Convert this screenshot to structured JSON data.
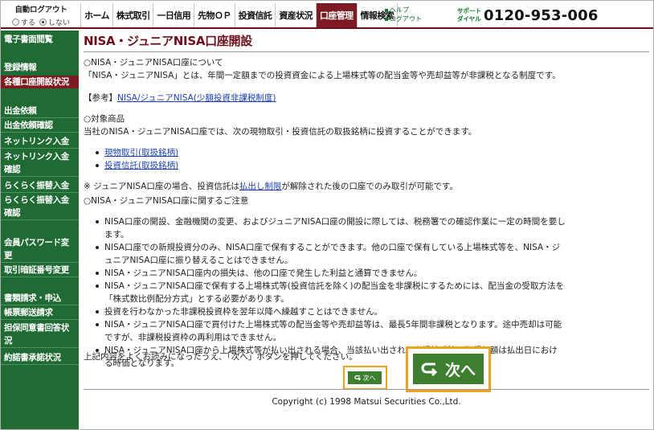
{
  "header": {
    "autologout_title": "自動ログアウト",
    "option_on": "する",
    "option_off": "しない",
    "tabs": [
      "ホーム",
      "株式取引",
      "一日信用",
      "先物ＯＰ",
      "投資信託",
      "資産状況",
      "口座管理",
      "情報検索"
    ],
    "active_tab": "口座管理",
    "help": "ヘルプ",
    "logout": "ログアウト",
    "support_line1": "サポート",
    "support_line2": "ダイヤル",
    "phone": "0120-953-006"
  },
  "sidebar": {
    "items": [
      "電子書面閲覧",
      "登録情報",
      "各種口座開設状況",
      "出金依頼",
      "出金依頼確認",
      "ネットリンク入金",
      "ネットリンク入金確認",
      "らくらく振替入金",
      "らくらく振替入金確認",
      "会員パスワード変更",
      "取引暗証番号変更",
      "書類請求・申込",
      "帳票郵送請求",
      "担保同意書回答状況",
      "約諾書承諾状況"
    ],
    "active_item": "各種口座開設状況"
  },
  "main": {
    "title": "NISA・ジュニアNISA口座開設",
    "about_heading": "○NISA・ジュニアNISA口座について",
    "about_text": "「NISA・ジュニアNISA」とは、年間一定額までの投資資金による上場株式等の配当金等や売却益等が非課税となる制度です。",
    "ref_label": "【参考】",
    "ref_link": "NISA/ジュニアNISA(少額投資非課税制度)",
    "target_heading": "○対象商品",
    "target_text": "当社のNISA・ジュニアNISA口座では、次の現物取引・投資信託の取扱銘柄に投資することができます。",
    "target_links": [
      "現物取引(取扱銘柄)",
      "投資信託(取扱銘柄)"
    ],
    "note_prefix": "※ ジュニアNISA口座の場合、投資信託は",
    "note_link": "払出し制限",
    "note_suffix": "が解除された後の口座でのみ取引が可能です。",
    "caution_heading": "○NISA・ジュニアNISA口座に関するご注意",
    "cautions": [
      "NISA口座の開設、金融機関の変更、およびジュニアNISA口座の開設に際しては、税務署での確認作業に一定の時間を要します。",
      "NISA口座での新規投資分のみ、NISA口座で保有することができます。他の口座で保有している上場株式等を、NISA・ジュニアNISA口座に振り替えることはできません。",
      "NISA・ジュニアNISA口座内の損失は、他の口座で発生した利益と通算できません。",
      "NISA・ジュニアNISA口座で保有する上場株式等(投資信託を除く)の配当金を非課税にするためには、配当金の受取方法を「株式数比例配分方式」とする必要があります。",
      "投資を行わなかった非課税投資枠を翌年以降へ繰越すことはできません。",
      "NISA・ジュニアNISA口座で買付けた上場株式等の配当金等や売却益等は、最長5年間非課税となります。途中売却は可能ですが、非課税投資枠の再利用はできません。",
      "NISA・ジュニアNISA口座から上場株式等が払い出される場合、当該払い出された上場株式等の取得価額は払出日における時価となります。"
    ],
    "confirm_text": "上記内容をよくお読みになったうえ、「次へ」ボタンを押してください。",
    "next_small_label": "次へ",
    "next_big_label": "次へ"
  },
  "footer": {
    "copyright": "Copyright (c) 1998 Matsui Securities Co.,Ltd."
  },
  "colors": {
    "accent_maroon": "#7d1a22",
    "sidebar_green": "#1f6b33",
    "button_green": "#3d7f2f",
    "highlight_orange": "#f0a21a"
  }
}
